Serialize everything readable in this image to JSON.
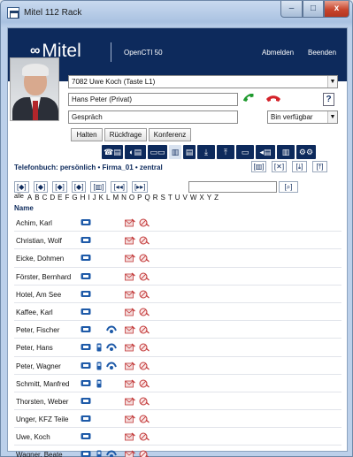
{
  "window": {
    "title": "Mitel 112 Rack",
    "minimize": "–",
    "maximize": "□",
    "close": "x"
  },
  "header": {
    "brand": "Mitel",
    "product": "OpenCTI 50",
    "logout": "Abmelden",
    "quit": "Beenden"
  },
  "line_select": {
    "value": "7082 Uwe Koch (Taste L1)"
  },
  "caller_field": {
    "value": "Hans Peter  (Privat)"
  },
  "call_state_field": {
    "value": "Gespräch"
  },
  "status_select": {
    "value": "Bin verfügbar"
  },
  "help_label": "?",
  "call_buttons": {
    "hold": "Halten",
    "consult": "Rückfrage",
    "conference": "Konferenz"
  },
  "toolbar": {
    "items": [
      "☎▤",
      "◐▤",
      "▭▭",
      "▥",
      "▤",
      "⤓",
      "⤒",
      "▭",
      "◂▤",
      "▥",
      "⚙⚙"
    ]
  },
  "phonebook": {
    "label": "Telefonbuch: persönlich • Firma_01 • zentral",
    "icons": [
      "[▥]",
      "[✕]",
      "[⤓]",
      "[⤒]"
    ]
  },
  "nav": {
    "buttons": [
      "[◆]",
      "[◆]",
      "[◆]",
      "[◆]",
      "[▥]",
      "[◂◂]",
      "[▸▸]"
    ],
    "search_button": "[⌕]"
  },
  "alphabet": [
    "alle",
    "A",
    "B",
    "C",
    "D",
    "E",
    "F",
    "G",
    "H",
    "I",
    "J",
    "K",
    "L",
    "M",
    "N",
    "O",
    "P",
    "Q",
    "R",
    "S",
    "T",
    "U",
    "V",
    "W",
    "X",
    "Y",
    "Z"
  ],
  "list": {
    "column_name": "Name",
    "rows": [
      {
        "name": "Achim, Karl",
        "mobile": false,
        "blue": false
      },
      {
        "name": "Christian, Wolf",
        "mobile": false,
        "blue": false
      },
      {
        "name": "Eicke, Dohmen",
        "mobile": false,
        "blue": false
      },
      {
        "name": "Förster, Bernhard",
        "mobile": false,
        "blue": false
      },
      {
        "name": "Hotel, Am See",
        "mobile": false,
        "blue": false
      },
      {
        "name": "Kaffee, Karl",
        "mobile": false,
        "blue": false
      },
      {
        "name": "Peter, Fischer",
        "mobile": false,
        "blue": true
      },
      {
        "name": "Peter, Hans",
        "mobile": true,
        "blue": true
      },
      {
        "name": "Peter, Wagner",
        "mobile": true,
        "blue": true
      },
      {
        "name": "Schmitt, Manfred",
        "mobile": true,
        "blue": false
      },
      {
        "name": "Thorsten, Weber",
        "mobile": false,
        "blue": false
      },
      {
        "name": "Unger, KFZ Teile",
        "mobile": false,
        "blue": false
      },
      {
        "name": "Uwe, Koch",
        "mobile": false,
        "blue": false
      },
      {
        "name": "Wagner, Beate",
        "mobile": true,
        "blue": true
      }
    ]
  },
  "colors": {
    "navy": "#0d2a5c",
    "green_handset": "#1f9a2e",
    "red_handset": "#d4222a"
  }
}
